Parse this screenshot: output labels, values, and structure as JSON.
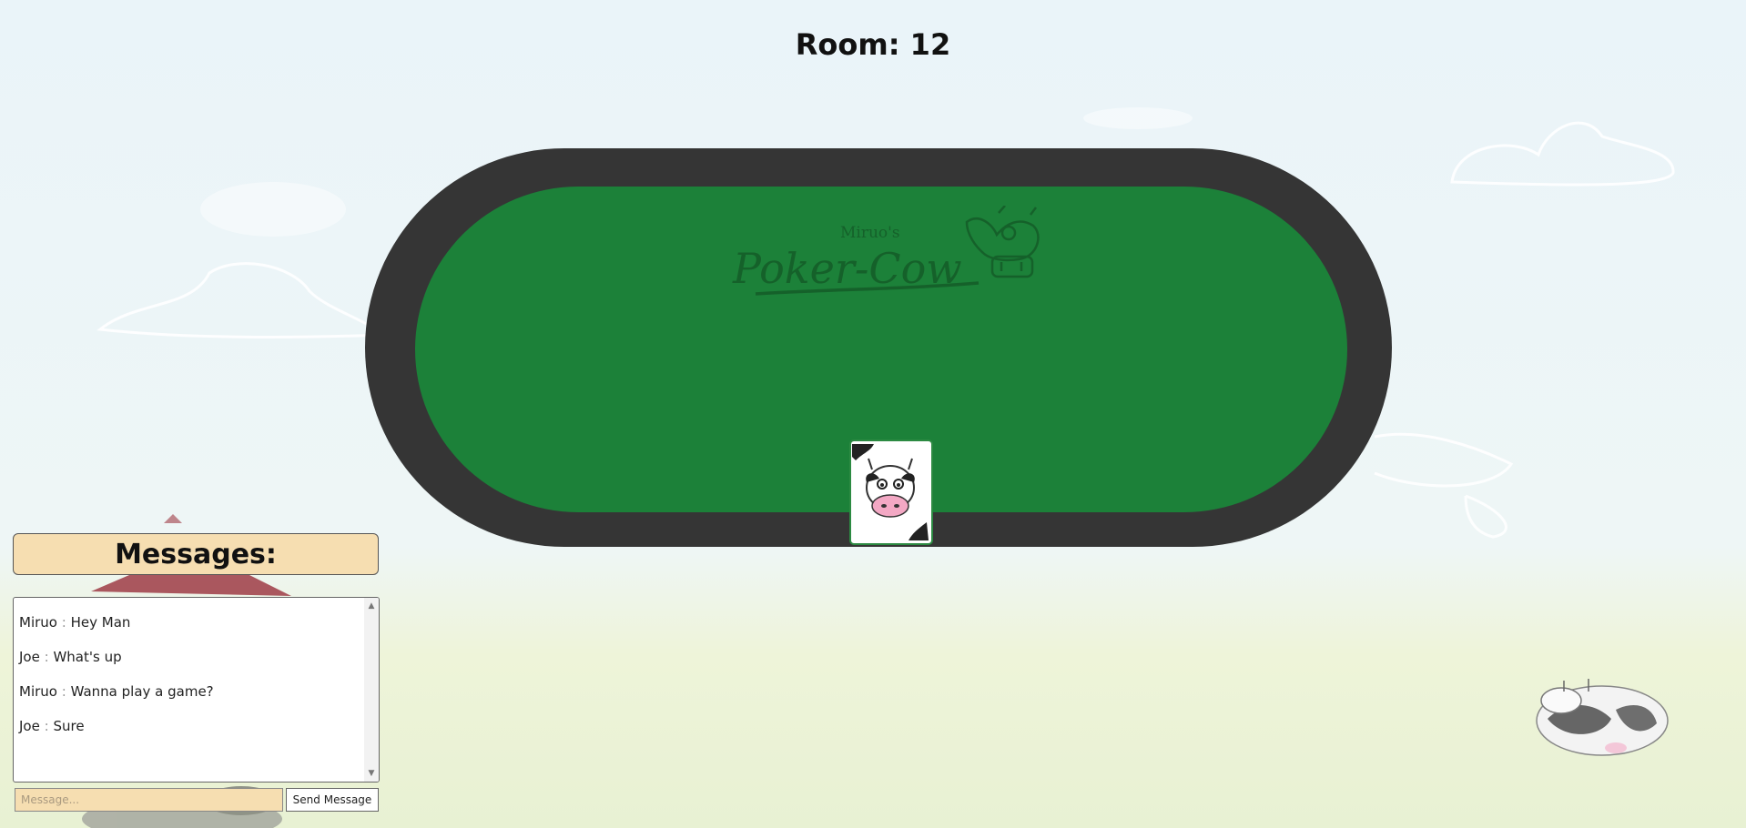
{
  "room": {
    "label": "Room: 12"
  },
  "table": {
    "logo_subtitle": "Miruo's",
    "logo_title": "Poker-Cow",
    "rim_color": "#353535",
    "felt_color": "#1c8139"
  },
  "chat": {
    "header": "Messages:",
    "messages": [
      {
        "user": "Miruo",
        "sep": ":",
        "text": "Hey Man"
      },
      {
        "user": "Joe",
        "sep": ":",
        "text": "What's up"
      },
      {
        "user": "Miruo",
        "sep": ":",
        "text": "Wanna play a game?"
      },
      {
        "user": "Joe",
        "sep": ":",
        "text": "Sure"
      }
    ],
    "input_placeholder": "Message...",
    "send_label": "Send Message"
  },
  "colors": {
    "sky": "#eaf4f9",
    "grass": "#e8f1d3",
    "panel_tan": "#f6deb1"
  },
  "icons": {
    "deck": "cow-card-deck-icon",
    "logo": "cow-head-logo-icon",
    "decor_cow": "cow-icon",
    "decor_barn": "barn-icon"
  }
}
